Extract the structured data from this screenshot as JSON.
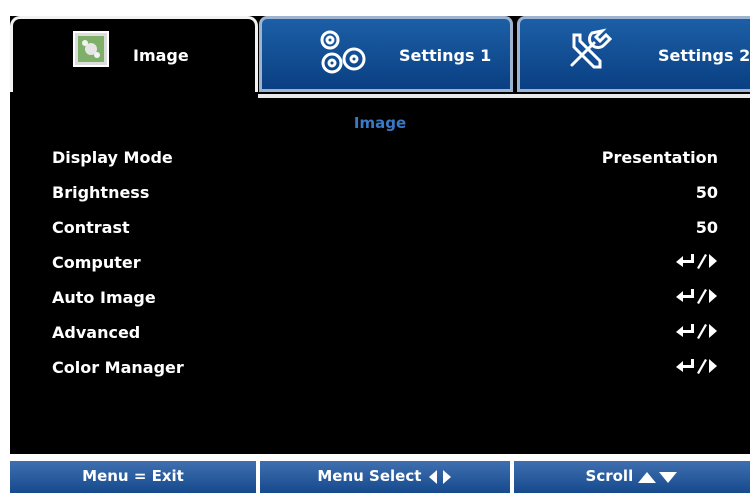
{
  "tabs": [
    {
      "label": "Image",
      "icon": "image-icon",
      "active": true
    },
    {
      "label": "Settings 1",
      "icon": "gears-icon",
      "active": false
    },
    {
      "label": "Settings 2",
      "icon": "tools-icon",
      "active": false
    }
  ],
  "section_title": "Image",
  "menu": [
    {
      "label": "Display Mode",
      "value": "Presentation"
    },
    {
      "label": "Brightness",
      "value": "50"
    },
    {
      "label": "Contrast",
      "value": "50"
    },
    {
      "label": "Computer",
      "value": "",
      "icon": "enter-right-icon"
    },
    {
      "label": "Auto Image",
      "value": "",
      "icon": "enter-right-icon"
    },
    {
      "label": "Advanced",
      "value": "",
      "icon": "enter-right-icon"
    },
    {
      "label": "Color Manager",
      "value": "",
      "icon": "enter-right-icon"
    }
  ],
  "footer": {
    "exit": "Menu = Exit",
    "select": "Menu Select",
    "scroll": "Scroll"
  },
  "colors": {
    "background": "#000000",
    "tab_blue": "#0a3f83",
    "accent_text": "#3a79c6",
    "text": "#ffffff"
  }
}
